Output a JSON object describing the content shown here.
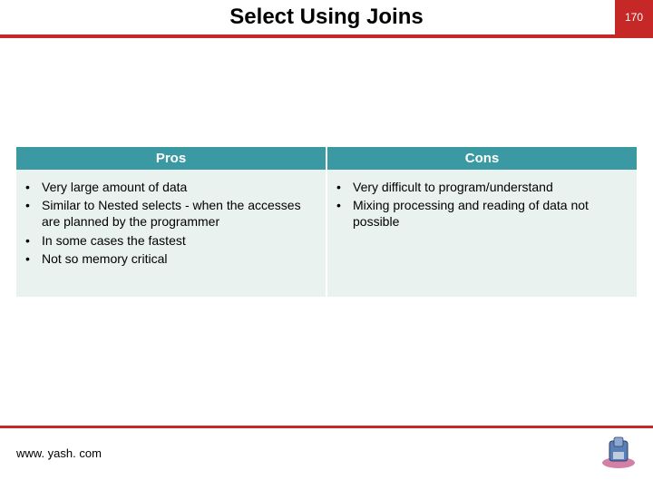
{
  "header": {
    "title": "Select Using Joins",
    "page_number": "170"
  },
  "table": {
    "pros_header": "Pros",
    "cons_header": "Cons",
    "pros": [
      "Very large amount of data",
      "Similar to Nested selects - when the accesses are planned by the programmer",
      "In some cases the fastest",
      "Not so memory critical"
    ],
    "cons": [
      "Very difficult to program/understand",
      "Mixing processing and reading of data not possible"
    ]
  },
  "footer": {
    "url": "www. yash. com"
  }
}
